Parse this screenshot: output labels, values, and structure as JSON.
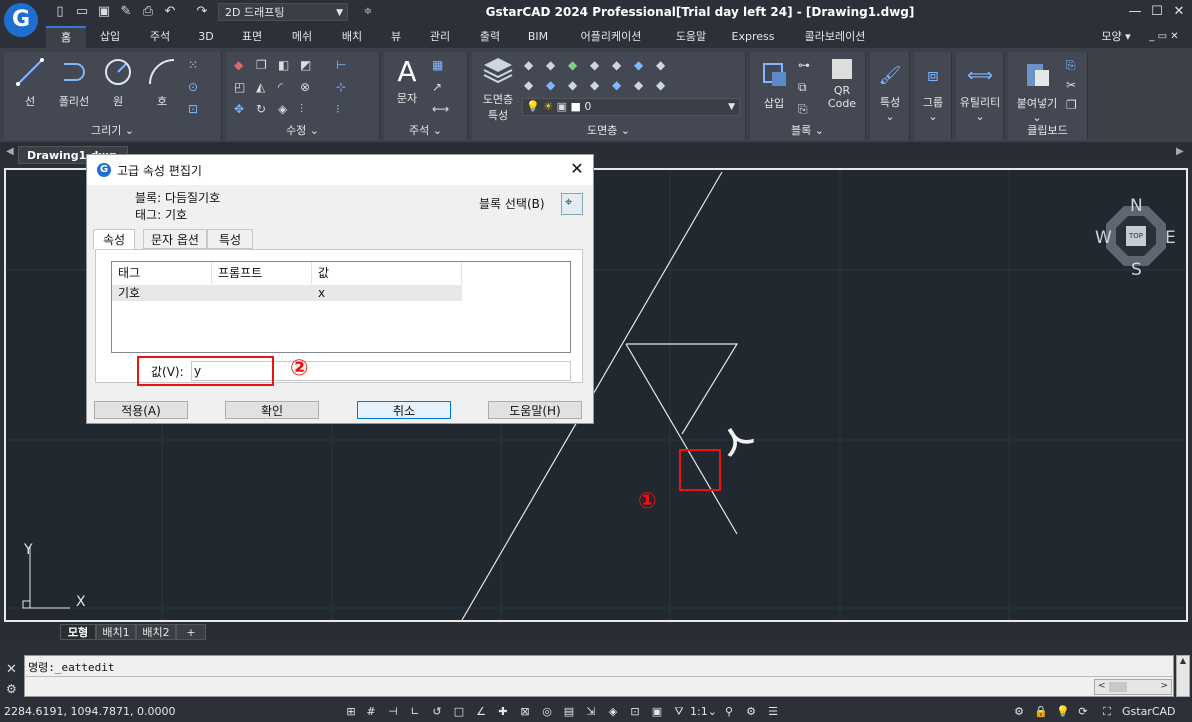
{
  "app": {
    "title": "GstarCAD 2024 Professional[Trial day left 24] - [Drawing1.dwg]",
    "workspace": "2D 드래프팅",
    "logo_letter": "G",
    "style_menu": "모양"
  },
  "ribbon_tabs": [
    "홈",
    "삽입",
    "주석",
    "3D",
    "표면",
    "메쉬",
    "배치",
    "뷰",
    "관리",
    "출력",
    "BIM",
    "어플리케이션",
    "도움말",
    "Express",
    "콜라보레이션"
  ],
  "ribbon": {
    "draw": {
      "title": "그리기",
      "line": "선",
      "polyline": "폴리선",
      "circle": "원",
      "arc": "호"
    },
    "modify": {
      "title": "수정"
    },
    "annotation": {
      "title": "주석",
      "text": "문자"
    },
    "layers": {
      "title": "도면층",
      "layer_props_1": "도면층",
      "layer_props_2": "특성",
      "current_layer": "0"
    },
    "block": {
      "title": "블록",
      "insert": "삽입",
      "qr_1": "QR",
      "qr_2": "Code"
    },
    "properties": {
      "label": "특성"
    },
    "groups": {
      "label": "그룹"
    },
    "utilities": {
      "label": "유틸리티"
    },
    "clipboard": {
      "title": "클립보드",
      "paste": "붙여넣기"
    }
  },
  "document_tab": "Drawing1.dwg",
  "viewcube": {
    "n": "N",
    "s": "S",
    "e": "E",
    "w": "W",
    "top": "TOP"
  },
  "ucs": {
    "x": "X",
    "y": "Y"
  },
  "canvas": {
    "text_value": "ㅅ",
    "marker_1": "①"
  },
  "layout_tabs": [
    "모형",
    "배치1",
    "배치2",
    "+"
  ],
  "command": {
    "line1": "명령:_eattedit"
  },
  "status": {
    "coords": "2284.6191, 1094.7871, 0.0000",
    "scale": "1:1",
    "app_label": "GstarCAD"
  },
  "dialog": {
    "title": "고급 속성 편집기",
    "block_line": "블록: 다듬질기호",
    "tag_line": "태그: 기호",
    "select_block": "블록 선택(B)",
    "tabs": [
      "속성",
      "문자 옵션",
      "특성"
    ],
    "table_headers": [
      "태그",
      "프롬프트",
      "값"
    ],
    "rows": [
      {
        "tag": "기호",
        "prompt": "",
        "value": "x"
      }
    ],
    "value_label": "값(V):",
    "value_text": "y",
    "marker_2": "②",
    "buttons": {
      "apply": "적용(A)",
      "ok": "확인",
      "cancel": "취소",
      "help": "도움말(H)"
    }
  },
  "colors": {
    "canvas": "#212830",
    "ribbon": "#3c4049",
    "annotation_red": "#ee1111",
    "accent": "#1f6fd1"
  }
}
